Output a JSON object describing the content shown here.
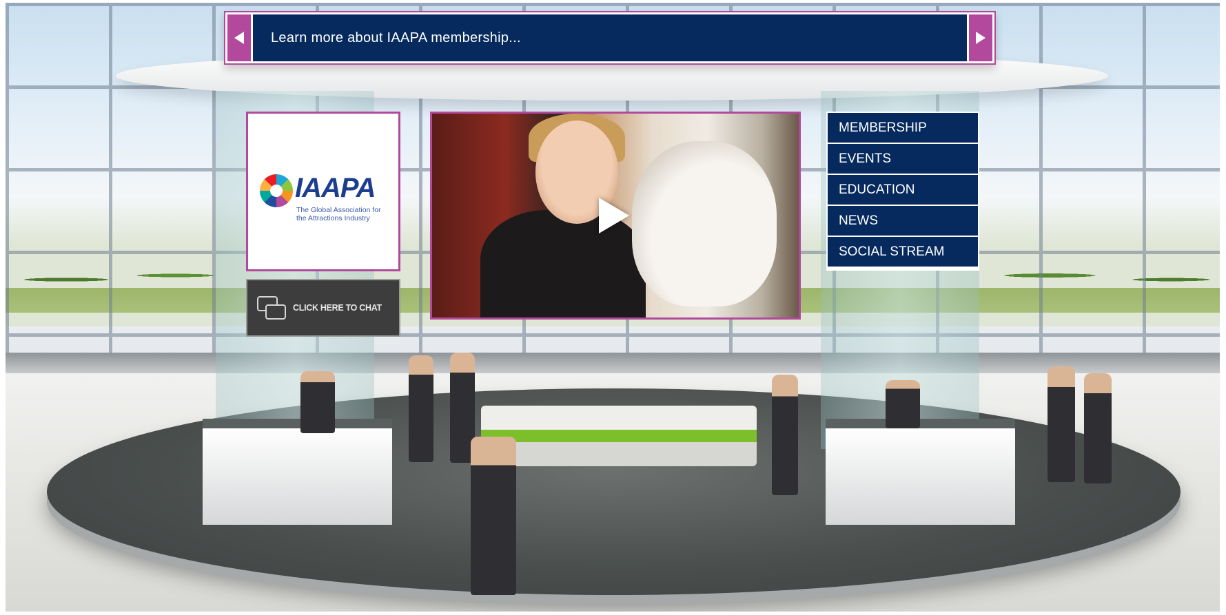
{
  "banner": {
    "text": "Learn more about IAAPA membership...",
    "prev_icon": "triangle-left-icon",
    "next_icon": "triangle-right-icon"
  },
  "logo": {
    "wordmark": "IAAPA",
    "tagline": "The Global Association for the Attractions Industry"
  },
  "chat": {
    "label": "CLICK HERE TO CHAT",
    "icon": "chat-bubbles-icon"
  },
  "video": {
    "play_icon": "play-icon"
  },
  "menu": {
    "items": [
      {
        "label": "MEMBERSHIP"
      },
      {
        "label": "EVENTS"
      },
      {
        "label": "EDUCATION"
      },
      {
        "label": "NEWS"
      },
      {
        "label": "SOCIAL STREAM"
      }
    ]
  },
  "colors": {
    "navy": "#062a5e",
    "magenta": "#b3499c",
    "chat_bg": "#3d3d3d"
  }
}
